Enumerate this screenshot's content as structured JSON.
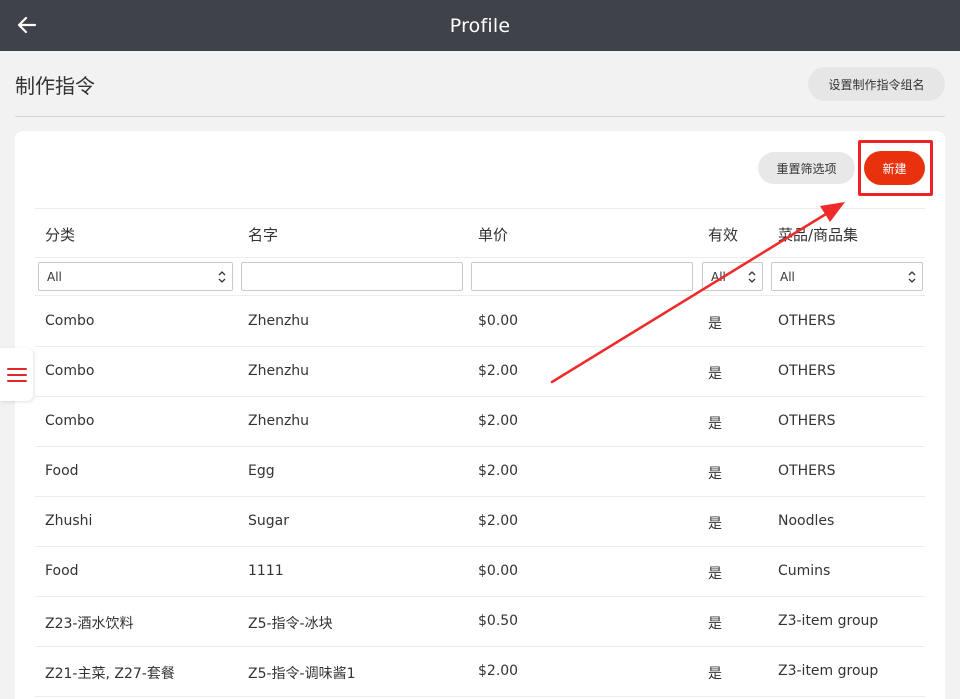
{
  "header": {
    "title": "Profile",
    "back_icon": "arrow-left-icon"
  },
  "page": {
    "title": "制作指令",
    "group_name_button": "设置制作指令组名"
  },
  "toolbar": {
    "reset_label": "重置筛选项",
    "new_label": "新建"
  },
  "table": {
    "columns": [
      "分类",
      "名字",
      "单价",
      "有效",
      "菜品/商品集"
    ],
    "filters": {
      "category": "All",
      "name": "",
      "price": "",
      "valid": "All",
      "itemset": "All"
    },
    "rows": [
      [
        "Combo",
        "Zhenzhu",
        "$0.00",
        "是",
        "OTHERS"
      ],
      [
        "Combo",
        "Zhenzhu",
        "$2.00",
        "是",
        "OTHERS"
      ],
      [
        "Combo",
        "Zhenzhu",
        "$2.00",
        "是",
        "OTHERS"
      ],
      [
        "Food",
        "Egg",
        "$2.00",
        "是",
        "OTHERS"
      ],
      [
        "Zhushi",
        "Sugar",
        "$2.00",
        "是",
        "Noodles"
      ],
      [
        "Food",
        "1111",
        "$0.00",
        "是",
        "Cumins"
      ],
      [
        "Z23-酒水饮料",
        "Z5-指令-冰块",
        "$0.50",
        "是",
        "Z3-item group"
      ],
      [
        "Z21-主菜, Z27-套餐",
        "Z5-指令-调味酱1",
        "$2.00",
        "是",
        "Z3-item group"
      ]
    ]
  },
  "sidebar": {
    "toggle_icon": "hamburger-menu-icon"
  },
  "colors": {
    "topbar": "#3f4248",
    "accent": "#e8320e",
    "annotation": "#ee2222"
  }
}
